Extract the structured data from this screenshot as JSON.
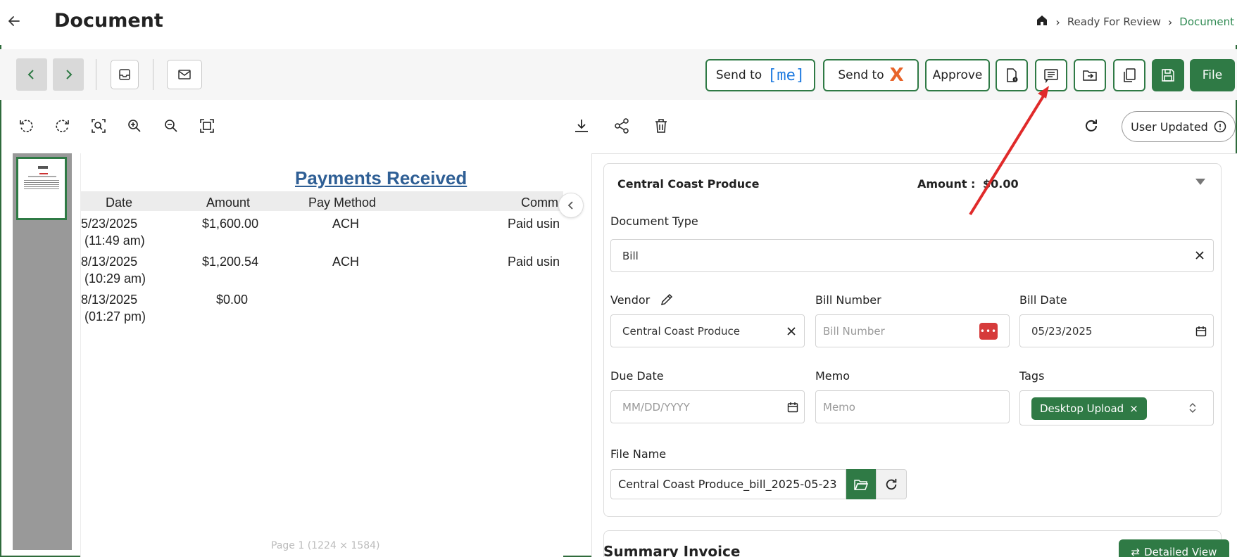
{
  "header": {
    "title": "Document",
    "breadcrumb": {
      "home_icon": "home-icon",
      "items": [
        "Ready For Review",
        "Document"
      ]
    }
  },
  "toolbar": {
    "send_to_me_label": "Send to",
    "me_logo_text": "[me]",
    "send_to_x_label": "Send to",
    "x_logo_text": "X",
    "approve_label": "Approve",
    "file_label": "File",
    "icons": [
      "chevron-left-icon",
      "chevron-right-icon",
      "inbox-icon",
      "mail-icon",
      "document-info-icon",
      "comment-icon",
      "move-folder-icon",
      "copy-icon",
      "save-icon"
    ]
  },
  "viewer": {
    "tools": [
      "rotate-left-icon",
      "rotate-right-icon",
      "zoom-selection-icon",
      "zoom-in-icon",
      "zoom-out-icon",
      "fit-screen-icon",
      "download-icon",
      "share-icon",
      "trash-icon",
      "refresh-icon"
    ],
    "status_label": "User Updated",
    "document": {
      "heading": "Payments Received",
      "columns": [
        "Date",
        "Amount",
        "Pay Method",
        "Comm"
      ],
      "rows": [
        {
          "date": "5/23/2025",
          "time": "(11:49 am)",
          "amount": "$1,600.00",
          "method": "ACH",
          "comment": "Paid usin"
        },
        {
          "date": "8/13/2025",
          "time": "(10:29 am)",
          "amount": "$1,200.54",
          "method": "ACH",
          "comment": "Paid usin"
        },
        {
          "date": "8/13/2025",
          "time": "(01:27 pm)",
          "amount": "$0.00",
          "method": "",
          "comment": ""
        }
      ]
    },
    "page_indicator": "Page 1 (1224 × 1584)"
  },
  "form": {
    "vendor_title": "Central Coast Produce",
    "amount_label": "Amount :",
    "amount_value": "$0.00",
    "document_type_label": "Document Type",
    "document_type_value": "Bill",
    "vendor_label": "Vendor",
    "vendor_value": "Central Coast Produce",
    "bill_number_label": "Bill Number",
    "bill_number_placeholder": "Bill Number",
    "bill_date_label": "Bill Date",
    "bill_date_value": "05/23/2025",
    "due_date_label": "Due Date",
    "due_date_placeholder": "MM/DD/YYYY",
    "memo_label": "Memo",
    "memo_placeholder": "Memo",
    "tags_label": "Tags",
    "tag_value": "Desktop Upload",
    "file_name_label": "File Name",
    "file_name_value": "Central Coast Produce_bill_2025-05-23",
    "summary_title": "Summary Invoice",
    "detailed_view_label": "Detailed View"
  },
  "colors": {
    "accent": "#2f7a45",
    "heading_blue": "#2f5f95",
    "annotation_arrow": "#e02a2a",
    "badge_red": "#d63b3b"
  }
}
